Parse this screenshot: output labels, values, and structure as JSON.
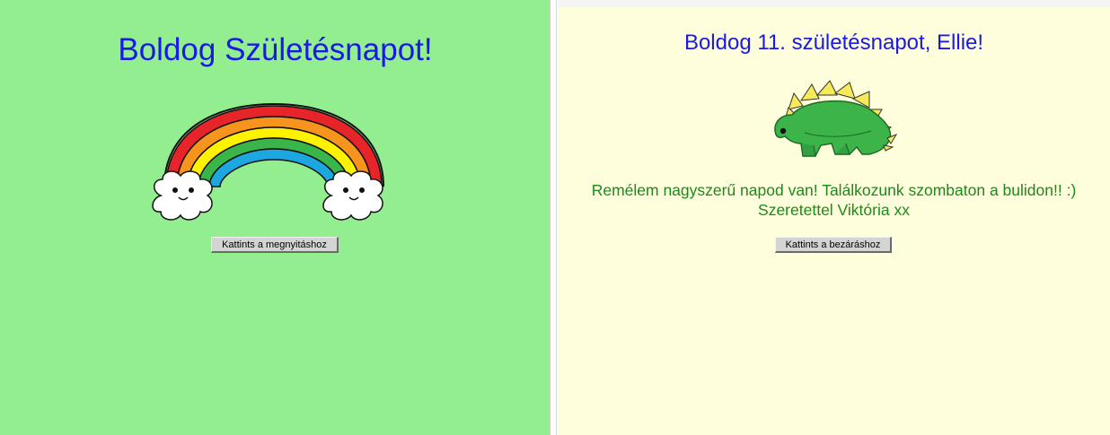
{
  "left_panel": {
    "title": "Boldog Születésnapot!",
    "image": "rainbow-with-clouds",
    "open_button_label": "Kattints a megnyitáshoz",
    "background": "#92ee8f"
  },
  "right_panel": {
    "title": "Boldog 11. születésnapot, Ellie!",
    "image": "green-stegosaurus",
    "message_line1": "Remélem nagyszerű napod van! Találkozunk szombaton a bulidon!! :)",
    "message_line2": "Szeretettel Viktória xx",
    "close_button_label": "Kattints a bezáráshoz",
    "background": "#fefedc"
  },
  "colors": {
    "title": "#1a1ae6",
    "message": "#1b8a1b"
  }
}
